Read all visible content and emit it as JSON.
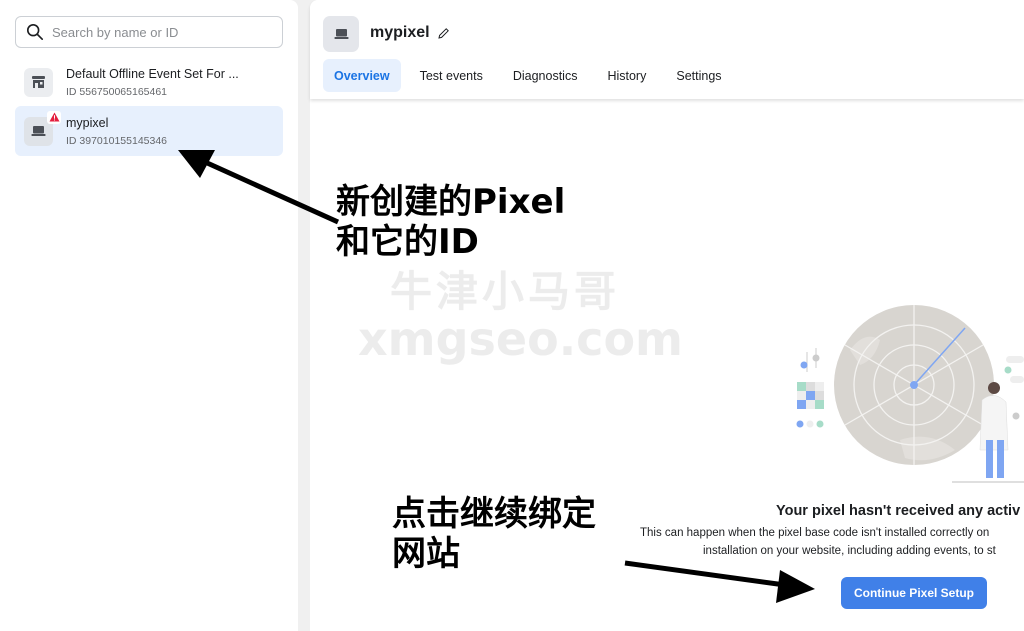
{
  "sidebar": {
    "search": {
      "placeholder": "Search by name or ID",
      "value": "",
      "icon": "search-icon"
    },
    "items": [
      {
        "name": "Default Offline Event Set For ...",
        "id_label": "ID 556750065165461",
        "icon": "store-icon",
        "selected": false
      },
      {
        "name": "mypixel",
        "id_label": "ID 397010155145346",
        "icon": "laptop-icon",
        "badge": "warning-icon",
        "selected": true
      }
    ]
  },
  "header": {
    "title": "mypixel",
    "icon": "laptop-icon",
    "edit_icon": "pencil-icon",
    "tabs": [
      {
        "label": "Overview",
        "active": true
      },
      {
        "label": "Test events",
        "active": false
      },
      {
        "label": "Diagnostics",
        "active": false
      },
      {
        "label": "History",
        "active": false
      },
      {
        "label": "Settings",
        "active": false
      }
    ]
  },
  "empty_state": {
    "illustration": "radar-illustration",
    "title": "Your pixel hasn't received any activ",
    "description_line1": "This can happen when the pixel base code isn't installed correctly on",
    "description_line2": "installation on your website, including adding events, to st",
    "button_label": "Continue Pixel Setup"
  },
  "annotations": {
    "pixel_note_line1": "新创建的Pixel",
    "pixel_note_line2": "和它的ID",
    "setup_note_line1": "点击继续绑定",
    "setup_note_line2": "网站"
  },
  "watermark": {
    "line1": "牛津小马哥",
    "line2": "xmgseo.com"
  },
  "colors": {
    "accent": "#1b74e4",
    "button": "#4080e8",
    "selected_bg": "#e7f0fd",
    "warning": "#e41e3f",
    "radar": "#d8d5d0",
    "radar_needle": "#7fa6f2"
  }
}
